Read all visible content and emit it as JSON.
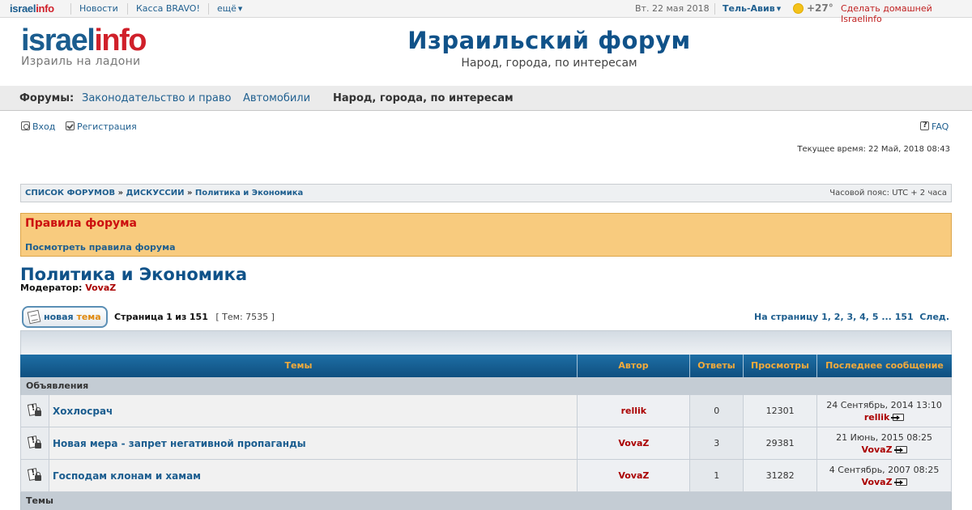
{
  "topbar": {
    "logo_part1": "israel",
    "logo_part2": "info",
    "links": [
      "Новости",
      "Касса BRAVO!",
      "ещё"
    ],
    "date": "Вт. 22 мая 2018",
    "city": "Тель-Авив",
    "temperature": "+27°",
    "homepage_link": "Сделать домашней Israelinfo",
    "colors": {
      "brand_blue": "#1b5d8f",
      "brand_red": "#d0202a"
    }
  },
  "header": {
    "logo_part1": "israel",
    "logo_part2": "info",
    "tagline": "Израиль на ладони",
    "title": "Израильский форум",
    "subtitle": "Народ, города, по интересам"
  },
  "forum_nav": {
    "label": "Форумы:",
    "items": [
      "Законодательство и право",
      "Автомобили",
      "Народ, города, по интересам"
    ]
  },
  "userbar": {
    "login": "Вход",
    "register": "Регистрация",
    "faq": "FAQ",
    "current_time": "Текущее время: 22 Май, 2018 08:43"
  },
  "breadcrumbs": {
    "items": [
      "СПИСОК ФОРУМОВ",
      "ДИСКУССИИ",
      "Политика и Экономика"
    ],
    "separator": "»",
    "timezone": "Часовой пояс: UTC + 2 часа"
  },
  "rules": {
    "title": "Правила форума",
    "link": "Посмотреть правила форума",
    "colors": {
      "background": "#f8cb7e",
      "title": "#cc1010"
    }
  },
  "forum": {
    "title": "Политика и Экономика",
    "moderator_label": "Модератор:",
    "moderator": "VovaZ"
  },
  "toolbar": {
    "new_topic_part1": "новая",
    "new_topic_part2": "тема",
    "page_label_prefix": "Страница",
    "page_current": "1",
    "page_of": "из",
    "page_total": "151",
    "topics_count": "[ Тем: 7535 ]",
    "pagination_label": "На страницу",
    "pages": [
      "1",
      "2",
      "3",
      "4",
      "5"
    ],
    "ellipsis": "...",
    "last_page": "151",
    "next": "След."
  },
  "table": {
    "headers": [
      "Темы",
      "Автор",
      "Ответы",
      "Просмотры",
      "Последнее сообщение"
    ],
    "category_announcements": "Объявления",
    "category_topics": "Темы",
    "rows": [
      {
        "icon": "locked-announcement-icon",
        "title": "Хохлосрач",
        "author": "rellik",
        "replies": "0",
        "views": "12301",
        "last_date": "24 Сентябрь, 2014 13:10",
        "last_user": "rellik"
      },
      {
        "icon": "locked-announcement-icon",
        "title": "Новая мера - запрет негативной пропаганды",
        "author": "VovaZ",
        "replies": "3",
        "views": "29381",
        "last_date": "21 Июнь, 2015 08:25",
        "last_user": "VovaZ"
      },
      {
        "icon": "locked-announcement-icon",
        "title": "Господам клонам и хамам",
        "author": "VovaZ",
        "replies": "1",
        "views": "31282",
        "last_date": "4 Сентябрь, 2007 08:25",
        "last_user": "VovaZ"
      }
    ]
  }
}
